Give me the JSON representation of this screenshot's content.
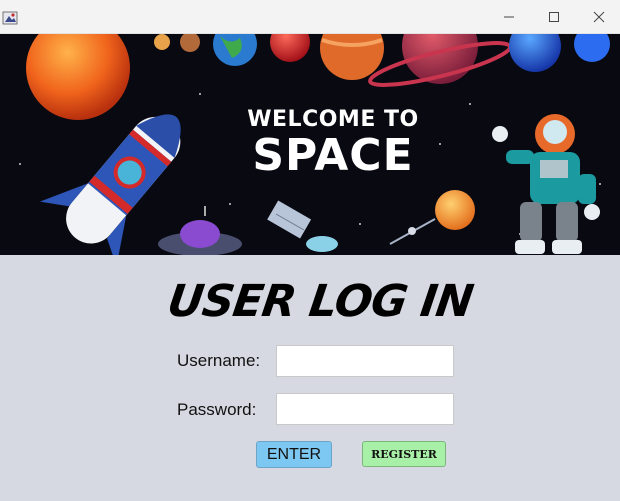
{
  "window": {
    "title": "",
    "controls": {
      "minimize": "minimize-icon",
      "maximize": "maximize-icon",
      "close": "close-icon"
    }
  },
  "banner": {
    "line1": "WELCOME TO",
    "line2": "SPACE"
  },
  "login": {
    "title": "USER LOG IN",
    "username_label": "Username:",
    "username_value": "",
    "password_label": "Password:",
    "password_value": "",
    "enter_label": "ENTER",
    "register_label": "REGISTER"
  },
  "colors": {
    "panel_bg": "#d6d9e1",
    "enter_button": "#7dc8f2",
    "register_button": "#a8f0a8",
    "banner_bg": "#090911"
  }
}
